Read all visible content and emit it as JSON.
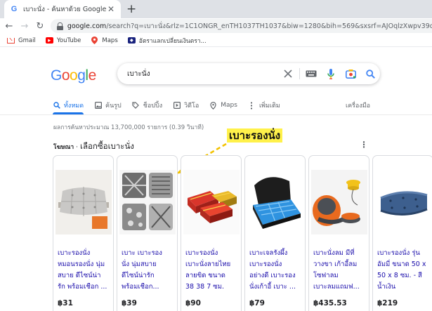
{
  "browser": {
    "tab_title": "เบาะนั่ง - ค้นหาด้วย Google",
    "close_glyph": "✕",
    "newtab_glyph": "+",
    "url_host": "google.com",
    "url_path": "/search?q=เบาะนั่ง&rlz=1C1ONGR_enTH1037TH1037&biw=1280&bih=569&sxsrf=AJOqlzXwpv39d8HGeEDBdX",
    "back_glyph": "←",
    "forward_glyph": "→",
    "reload_glyph": "↻"
  },
  "bookmarks": [
    {
      "label": "Gmail",
      "icon": "gmail-icon"
    },
    {
      "label": "YouTube",
      "icon": "youtube-icon"
    },
    {
      "label": "Maps",
      "icon": "maps-icon"
    },
    {
      "label": "อัตราแลกเปลี่ยนเงินตรา...",
      "icon": "bank-icon"
    }
  ],
  "logo": [
    "G",
    "o",
    "o",
    "g",
    "l",
    "e"
  ],
  "search": {
    "query": "เบาะนั่ง",
    "clear_glyph": "✕"
  },
  "tabs": [
    {
      "label": "ทั้งหมด",
      "icon": "search-icon",
      "active": true
    },
    {
      "label": "ค้นรูป",
      "icon": "image-icon",
      "active": false
    },
    {
      "label": "ช็อปปิ้ง",
      "icon": "tag-icon",
      "active": false
    },
    {
      "label": "วิดีโอ",
      "icon": "video-icon",
      "active": false
    },
    {
      "label": "Maps",
      "icon": "location-icon",
      "active": false
    },
    {
      "label": "เพิ่มเติม",
      "icon": "more-icon",
      "active": false
    }
  ],
  "tools_label": "เครื่องมือ",
  "result_stats": "ผลการค้นหาประมาณ 13,700,000 รายการ (0.39 วินาที)",
  "annotation": "เบาะรองนั่ง",
  "shopping": {
    "ad_label": "โฆษณา",
    "separator": "·",
    "title": "เลือกซื้อเบาะนั่ง",
    "more_glyph": "⋮"
  },
  "products": [
    {
      "name_lines": [
        "เบาะรองนั่ง",
        "หมอนรองนั่ง นุ่ม",
        "สบาย ดีไซน์น่า",
        "รัก พร้อมเชือก ..."
      ],
      "price": "฿31"
    },
    {
      "name_lines": [
        "เบาะ เบาะรอง",
        "นั่ง นุ่มสบาย",
        "ดีไซน์น่ารัก",
        "พร้อมเชือก..."
      ],
      "price": "฿39"
    },
    {
      "name_lines": [
        "เบาะรองนั่ง",
        "เบาะนั่งลายไทย",
        "ลายขิด ขนาด",
        "38 38 7 ซม."
      ],
      "price": "฿90"
    },
    {
      "name_lines": [
        "เบาะเจลรังผึ้ง",
        "เบาะรองนั่ง",
        "อย่างดี เบาะรอง",
        "นั่งเก้าอี้ เบาะ ..."
      ],
      "price": "฿79"
    },
    {
      "name_lines": [
        "เบาะนั่งลม มีที่",
        "วางขา เก้าอี้ลม",
        "โซฟาลม",
        "เบาะลมแถมฟ..."
      ],
      "price": "฿435.53"
    },
    {
      "name_lines": [
        "เบาะรองนั่ง รุ่น",
        "อัมมี่ ขนาด 50 x",
        "50 x 8 ซม. - สี",
        "น้ำเงิน"
      ],
      "price": "฿219"
    }
  ],
  "colors": {
    "link": "#1a0dab",
    "accent": "#1a73e8",
    "annotation_bg": "#fff14a",
    "annotation_arrow": "#f2c200"
  }
}
